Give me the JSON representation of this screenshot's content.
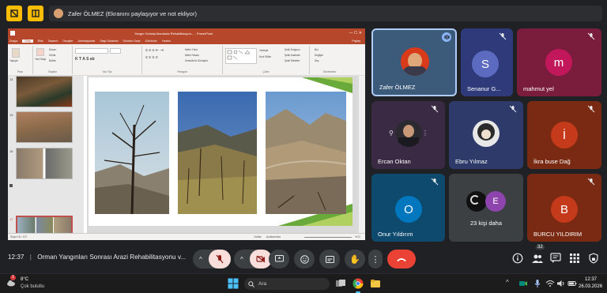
{
  "presenter_banner": {
    "text": "Zafer ÖLMEZ (Ekranını paylaşıyor ve not ekliyor)"
  },
  "ppt": {
    "window_title": "Yangın Gelmişi Alanlarda Rehabilitasyon... - PowerPoint",
    "tabs": [
      "Dosya",
      "Giriş",
      "Ekle",
      "Tasarım",
      "Geçişler",
      "Animasyonlar",
      "Slayt Gösterisi",
      "Gözden Geçir",
      "Görünüm",
      "Yardım"
    ],
    "active_tab": "Giriş",
    "share_label": "Paylaş",
    "ribbon_groups": [
      "Pano",
      "Slaytlar",
      "Yazı Tipi",
      "Paragraf",
      "Çizim",
      "Düzenleme"
    ],
    "ribbon_items": {
      "paste": "Yapıştır",
      "new_slide": "Yeni Slayt",
      "layout": "Düzen",
      "reset": "Sıfırla",
      "section": "Bölüm",
      "arrange": "Yerleştir",
      "quick_styles": "Hızlı Stiller",
      "shape_fill": "Şekil Dolgusu",
      "shape_outline": "Şekil Anahattı",
      "shape_effects": "Şekil Efektleri",
      "find": "Bul",
      "replace": "Değiştir",
      "select": "Seç",
      "text_direction": "Metin Yönü",
      "align_text": "Metni Hizala",
      "smartart": "SmartArt'a Dönüştür"
    },
    "slide_numbers": [
      "14",
      "15",
      "16",
      "17",
      "18"
    ],
    "slide_notes_hint": "Not yazmak için tıklatın",
    "status_left": "Slayt 18 / 137",
    "status_notes": "Notlar",
    "status_comments": "Açıklamalar",
    "zoom": "%72"
  },
  "participants": [
    {
      "name": "Zafer ÖLMEZ",
      "type": "video",
      "color": "#3c5a7a"
    },
    {
      "name": "Senanur G...",
      "initial": "S",
      "bg": "#2e3a7a",
      "avatar": "#5c6bc0"
    },
    {
      "name": "mahmut yel",
      "initial": "m",
      "bg": "#7a1c3c",
      "avatar": "#c2185b"
    },
    {
      "name": "Ercan Oktan",
      "type": "photo",
      "bg": "#3a2a44"
    },
    {
      "name": "Ebru Yılmaz",
      "type": "photo",
      "bg": "#2e3a6a"
    },
    {
      "name": "İkra buse Dağ",
      "initial": "İ",
      "bg": "#7a2a12",
      "avatar": "#c53a1a"
    },
    {
      "name": "Onur Yıldırım",
      "initial": "O",
      "bg": "#0e4a6e",
      "avatar": "#0277bd"
    },
    {
      "name": "23 kişi daha",
      "initial": "E",
      "bg": "#3c4043",
      "avatar": "#8e44ad"
    },
    {
      "name": "BURCU YILDIRIM",
      "initial": "B",
      "bg": "#7a2a12",
      "avatar": "#c53a1a"
    }
  ],
  "meeting": {
    "time": "12:37",
    "title": "Orman Yangınları Sonrası Arazi Rehabilitasyonu v...",
    "participant_count": "32"
  },
  "taskbar": {
    "weather_temp": "8°C",
    "weather_desc": "Çok bulutlu",
    "search_placeholder": "Ara",
    "clock_time": "12:37",
    "clock_date": "26.03.2026",
    "notification_badge": "1"
  },
  "colors": {
    "ppt_accent": "#b7472a",
    "google_red": "#ea4335",
    "meet_bg": "#202124",
    "highlight_yellow": "#fbbc04"
  }
}
